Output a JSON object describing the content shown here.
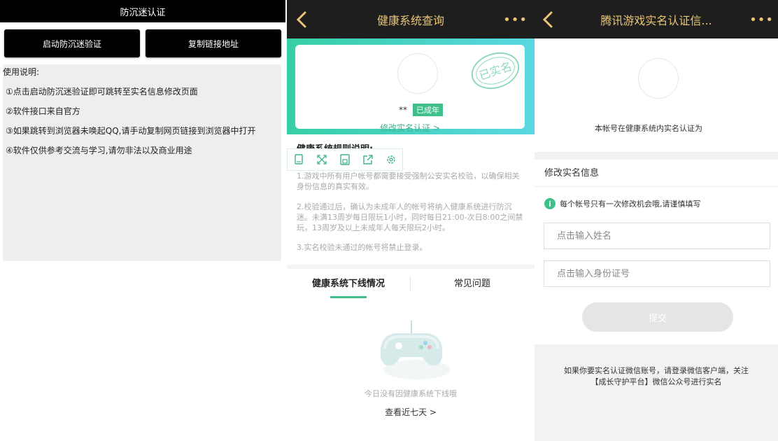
{
  "panel1": {
    "title": "防沉迷认证",
    "launch_button": "启动防沉迷验证",
    "copy_button": "复制链接地址",
    "usage_header": "使用说明:",
    "usage_lines": [
      "①点击启动防沉迷验证即可跳转至实名信息修改页面",
      "②软件接口来自官方",
      "③如果跳转到浏览器未唤起QQ,请手动复制网页链接到浏览器中打开",
      "④软件仅供参考交流与学习,请勿非法以及商业用途"
    ]
  },
  "panel2": {
    "nav_title": "健康系统查询",
    "more": "•••",
    "user_name": "**",
    "adult_badge": "已成年",
    "stamp_text": "已实名",
    "modify_link": "修改实名认证 >",
    "rules_title": "健康系统规则说明:",
    "rules": [
      "1.游戏中所有用户帐号都需要接受强制公安实名校验，以确保相关身份信息的真实有效。",
      "2.校验通过后，确认为未成年人的帐号将纳入健康系统进行防沉迷。未满13周岁每日限玩1小时，同时每日21:00-次日8:00之间禁玩，13周岁及以上未成年人每天限玩2小时。",
      "3.实名校验未通过的帐号将禁止登录。"
    ],
    "tab_offline": "健康系统下线情况",
    "tab_faq": "常见问题",
    "empty_text": "今日没有因健康系统下线哦",
    "seven_days": "查看近七天 >"
  },
  "panel3": {
    "nav_title": "腾讯游戏实名认证信...",
    "more": "•••",
    "status_text": "本帐号在健康系统内实名认证为",
    "section_title": "修改实名信息",
    "notice": "每个帐号只有一次修改机会哦,请谨慎填写",
    "name_placeholder": "点击输入姓名",
    "id_placeholder": "点击输入身份证号",
    "submit": "提交",
    "footer_line1": "如果你要实名认证微信账号，请登录微信客户端，关注",
    "footer_line2": "【成长守护平台】微信公众号进行实名"
  },
  "colors": {
    "accent_green": "#3fc08a",
    "nav_gold": "#e8c577",
    "nav_dark": "#1e1e1e"
  }
}
